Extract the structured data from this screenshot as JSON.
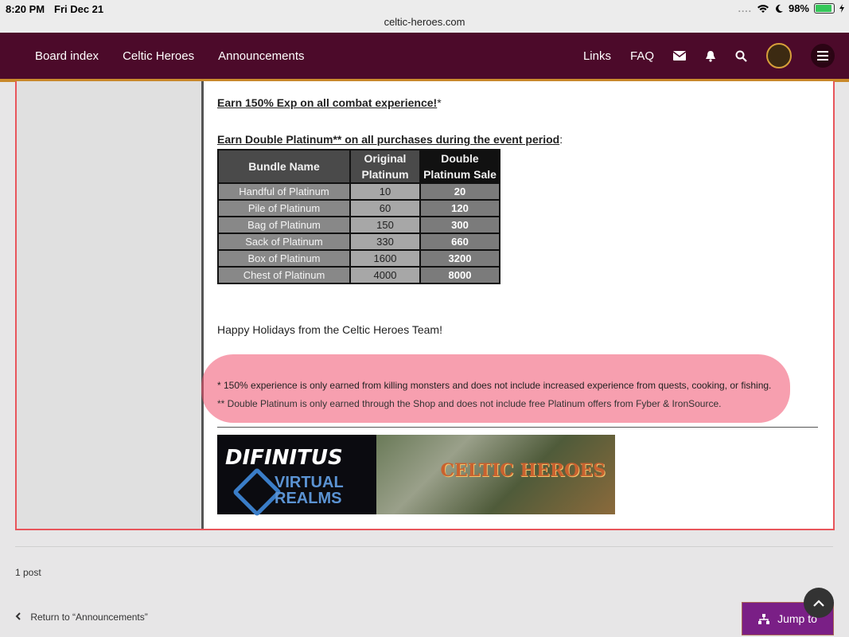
{
  "status_bar": {
    "time": "8:20 PM",
    "date": "Fri Dec 21",
    "url": "celtic-heroes.com",
    "signal": "....",
    "battery": "98%"
  },
  "nav": {
    "breadcrumbs": [
      "Board index",
      "Celtic Heroes",
      "Announcements"
    ],
    "links_label": "Links",
    "faq_label": "FAQ"
  },
  "post": {
    "line1_underlined": "Earn 150% Exp on all combat experience!",
    "line1_suffix": "*",
    "line2_underlined": "Earn Double Platinum** on all purchases during the event period",
    "line2_suffix": ":",
    "table": {
      "headers": [
        "Bundle Name",
        "Original Platinum",
        "Double Platinum Sale"
      ],
      "rows": [
        [
          "Handful of Platinum",
          "10",
          "20"
        ],
        [
          "Pile of Platinum",
          "60",
          "120"
        ],
        [
          "Bag of Platinum",
          "150",
          "300"
        ],
        [
          "Sack of Platinum",
          "330",
          "660"
        ],
        [
          "Box of Platinum",
          "1600",
          "3200"
        ],
        [
          "Chest of Platinum",
          "4000",
          "8000"
        ]
      ]
    },
    "holidays": "Happy Holidays from the Celtic Heroes Team!",
    "note1": "* 150% experience is only earned from killing monsters and does not include increased experience from quests, cooking, or fishing.",
    "note2": "** Double Platinum is only earned through the Shop and does not include free Platinum offers from Fyber & IronSource.",
    "banner": {
      "logo_line1": "DIFINITUS",
      "logo_line2": "VIRTUAL",
      "logo_line3": "REALMS",
      "game_title": "CELTIC HEROES"
    }
  },
  "footer": {
    "post_count": "1 post",
    "return_label": "Return to “Announcements”",
    "jump_label": "Jump to"
  },
  "colors": {
    "navbar": "#4c0a2a",
    "navbar_border": "#c9892b",
    "highlight": "#f0506e",
    "jump_button": "#7a1f86"
  }
}
